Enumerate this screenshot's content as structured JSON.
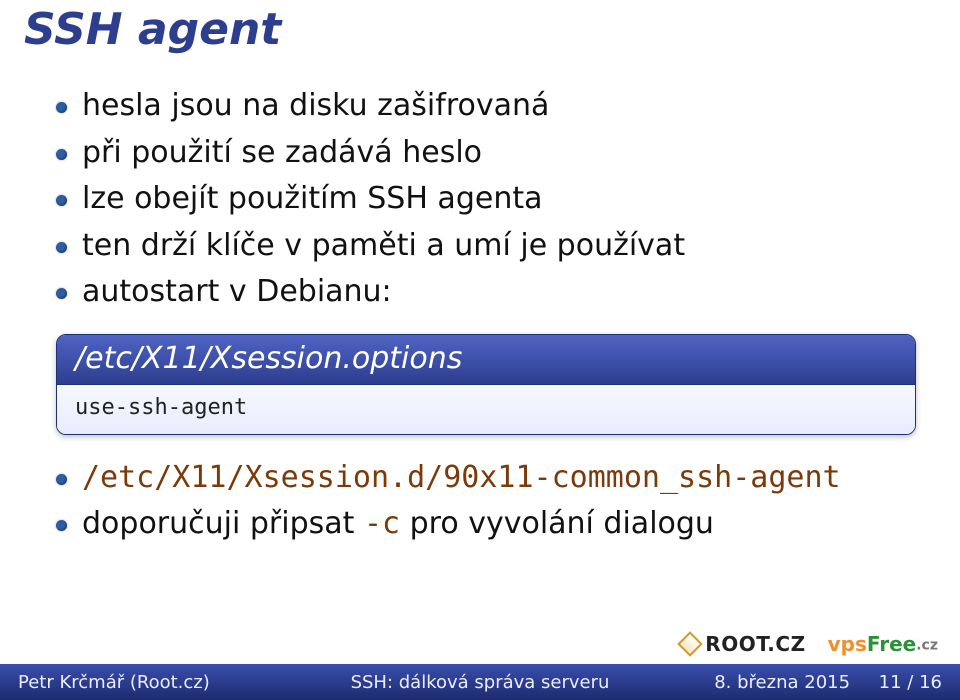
{
  "title": "SSH agent",
  "bullets_top": [
    "hesla jsou na disku zašifrovaná",
    "při použití se zadává heslo",
    "lze obejít použitím SSH agenta",
    "ten drží klíče v paměti a umí je používat",
    "autostart v Debianu:"
  ],
  "codebox": {
    "header": "/etc/X11/Xsession.options",
    "body": "use-ssh-agent"
  },
  "bullets_bottom": [
    {
      "mono": "/etc/X11/Xsession.d/90x11-common_ssh-agent",
      "rest": ""
    },
    {
      "mono": "-c",
      "rest_before": "doporučuji připsat ",
      "rest_after": " pro vyvolání dialogu"
    }
  ],
  "logos": {
    "root": "ROOT.CZ",
    "vps_a": "vps",
    "vps_b": "Free",
    "vps_c": ".cz"
  },
  "footer": {
    "left": "Petr Krčmář (Root.cz)",
    "center": "SSH: dálková správa serveru",
    "right": "8. března 2015",
    "page": "11 / 16"
  }
}
